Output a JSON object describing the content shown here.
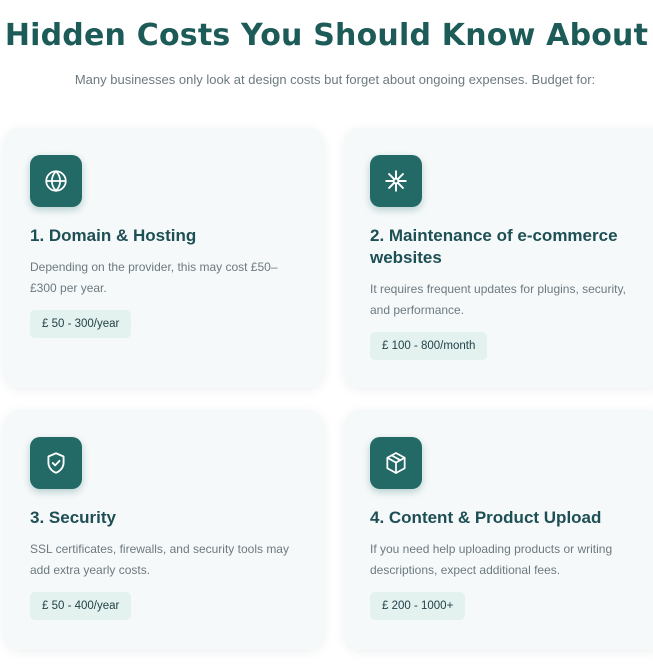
{
  "header": {
    "title": "Hidden Costs You Should Know About",
    "subtitle": "Many businesses only look at design costs but forget about ongoing expenses. Budget for:"
  },
  "cards": [
    {
      "icon": "globe-icon",
      "title": "1. Domain & Hosting",
      "description": "Depending on the provider, this may cost £50–£300 per year.",
      "price": "£ 50 - 300/year"
    },
    {
      "icon": "asterisk-sparkle-icon",
      "title": "2. Maintenance of e-commerce websites",
      "description": "It requires frequent updates for plugins, security, and performance.",
      "price": "£ 100 - 800/month"
    },
    {
      "icon": "shield-check-icon",
      "title": "3. Security",
      "description": "SSL certificates, firewalls, and security tools may add extra yearly costs.",
      "price": "£ 50 - 400/year"
    },
    {
      "icon": "box-package-icon",
      "title": "4. Content & Product Upload",
      "description": "If you need help uploading products or writing descriptions, expect additional fees.",
      "price": "£ 200 - 1000+"
    }
  ],
  "colors": {
    "accent": "#236a67",
    "title": "#1d5b59",
    "card_background": "#f6f9fa",
    "price_background": "#e3f1ef"
  }
}
